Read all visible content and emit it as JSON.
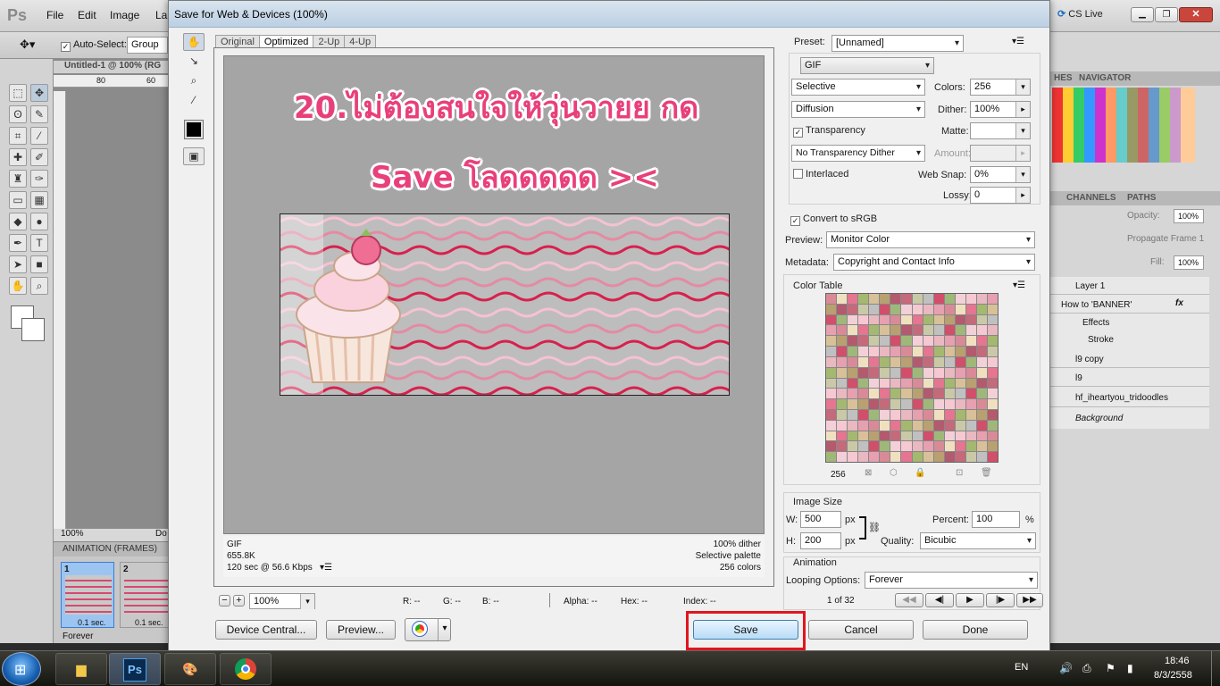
{
  "photoshop": {
    "logo": "Ps",
    "menu": [
      "File",
      "Edit",
      "Image",
      "La"
    ],
    "options": {
      "auto_select_label": "Auto-Select:",
      "auto_select_value": "Group"
    },
    "doc_tab": "Untitled-1 @ 100% (RG",
    "ruler_ticks": [
      "80",
      "60"
    ],
    "zoom": "100%",
    "doc_label": "Do",
    "cs_live": "CS Live",
    "panels": {
      "swatches_tabs": [
        "HES",
        "NAVIGATOR"
      ],
      "layers_tabs": [
        "CHANNELS",
        "PATHS"
      ],
      "opacity_label": "Opacity:",
      "opacity_value": "100%",
      "propagate": "Propagate Frame 1",
      "fill_label": "Fill:",
      "fill_value": "100%",
      "layers": [
        {
          "name": "Layer 1"
        },
        {
          "name": "How to  'BANNER'",
          "fx": "fx"
        },
        {
          "name": "Effects"
        },
        {
          "name": "Stroke"
        },
        {
          "name": "l9 copy"
        },
        {
          "name": "l9"
        },
        {
          "name": "hf_iheartyou_tridoodles"
        },
        {
          "name": "Background"
        }
      ]
    },
    "animation": {
      "title": "ANIMATION (FRAMES)",
      "frames": [
        {
          "num": "1",
          "delay": "0.1 sec."
        },
        {
          "num": "2",
          "delay": "0.1 sec."
        }
      ],
      "looping": "Forever"
    }
  },
  "dialog": {
    "title": "Save for Web & Devices (100%)",
    "tabs": [
      "Original",
      "Optimized",
      "2-Up",
      "4-Up"
    ],
    "active_tab": "Optimized",
    "overlay_line1": "20.ไม่ต้องสนใจให้วุ่นวายย กด",
    "overlay_line2": "Save โลดดดดด ><",
    "info": {
      "format": "GIF",
      "size": "655.8K",
      "speed": "120 sec @ 56.6 Kbps",
      "dither": "100% dither",
      "palette": "Selective palette",
      "colors": "256 colors"
    },
    "status": {
      "zoom": "100%",
      "r": "R: --",
      "g": "G: --",
      "b": "B: --",
      "alpha": "Alpha: --",
      "hex": "Hex: --",
      "index": "Index: --"
    },
    "settings": {
      "preset_label": "Preset:",
      "preset_value": "[Unnamed]",
      "format": "GIF",
      "reduction": "Selective",
      "colors_label": "Colors:",
      "colors_value": "256",
      "dither_algo": "Diffusion",
      "dither_label": "Dither:",
      "dither_value": "100%",
      "transparency": "Transparency",
      "matte_label": "Matte:",
      "trans_dither": "No Transparency Dither",
      "amount_label": "Amount:",
      "interlaced": "Interlaced",
      "websnap_label": "Web Snap:",
      "websnap_value": "0%",
      "lossy_label": "Lossy:",
      "lossy_value": "0",
      "convert_srgb": "Convert to sRGB",
      "preview_label": "Preview:",
      "preview_value": "Monitor Color",
      "metadata_label": "Metadata:",
      "metadata_value": "Copyright and Contact Info"
    },
    "color_table": {
      "title": "Color Table",
      "count": "256",
      "colors": [
        "#d98a97",
        "#c46a7a",
        "#e9b8c0",
        "#b8a070",
        "#f3d0d8",
        "#a4b870",
        "#d14f6a",
        "#f0e0c0",
        "#c9c9a8",
        "#e6a0b0",
        "#b35a6e",
        "#f5c8d2",
        "#d8c098",
        "#9fb87a",
        "#e57590",
        "#c0c0c0"
      ]
    },
    "image_size": {
      "title": "Image Size",
      "w_label": "W:",
      "w_value": "500",
      "h_label": "H:",
      "h_value": "200",
      "unit": "px",
      "percent_label": "Percent:",
      "percent_value": "100",
      "percent_unit": "%",
      "quality_label": "Quality:",
      "quality_value": "Bicubic"
    },
    "animation": {
      "title": "Animation",
      "looping_label": "Looping Options:",
      "looping_value": "Forever",
      "frame_counter": "1 of 32"
    },
    "buttons": {
      "device_central": "Device Central...",
      "preview": "Preview...",
      "save": "Save",
      "cancel": "Cancel",
      "done": "Done"
    },
    "highlight_color": "#e0161e"
  },
  "taskbar": {
    "lang": "EN",
    "time": "18:46",
    "date": "8/3/2558",
    "ps_label": "Ps"
  }
}
